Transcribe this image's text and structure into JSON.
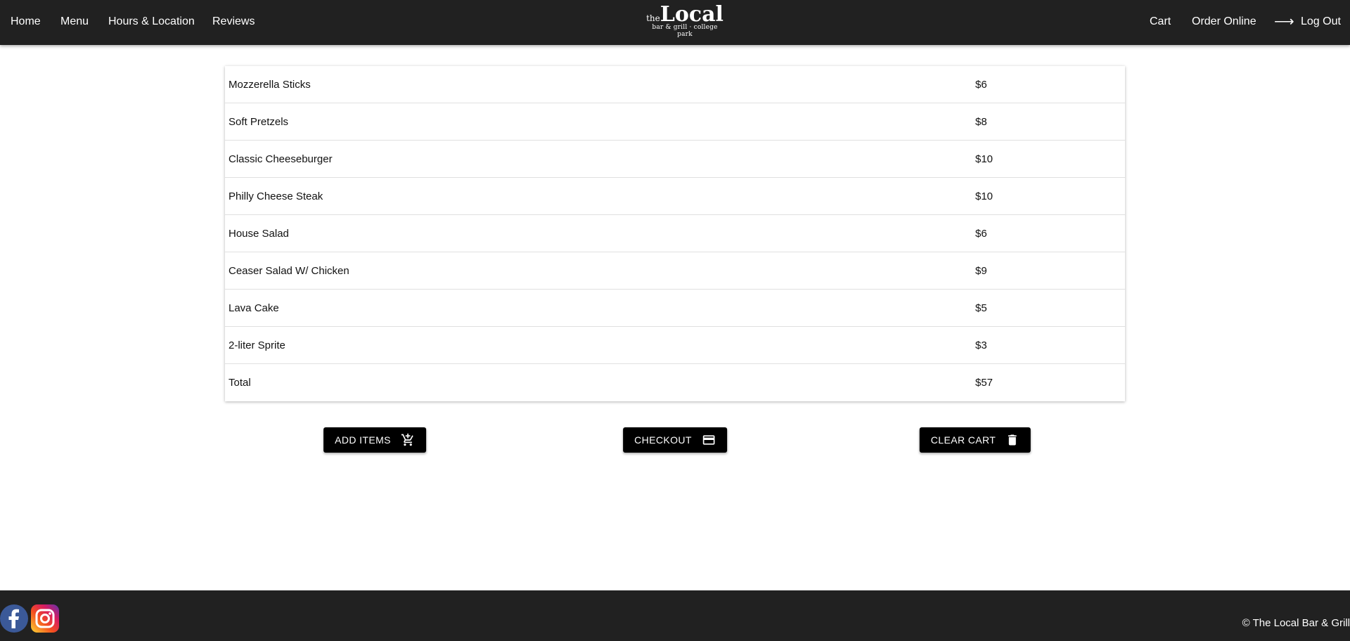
{
  "nav": {
    "left": [
      "Home",
      "Menu",
      "Hours & Location",
      "Reviews"
    ],
    "right": {
      "cart": "Cart",
      "order": "Order Online",
      "logout": "Log Out"
    },
    "logo": {
      "the": "the",
      "name": "Local",
      "tagline": "bar & grill · college park"
    }
  },
  "cart": {
    "items": [
      {
        "name": "Mozzerella Sticks",
        "price": "$6"
      },
      {
        "name": "Soft Pretzels",
        "price": "$8"
      },
      {
        "name": "Classic Cheeseburger",
        "price": "$10"
      },
      {
        "name": "Philly Cheese Steak",
        "price": "$10"
      },
      {
        "name": "House Salad",
        "price": "$6"
      },
      {
        "name": "Ceaser Salad W/ Chicken",
        "price": "$9"
      },
      {
        "name": "Lava Cake",
        "price": "$5"
      },
      {
        "name": "2-liter Sprite",
        "price": "$3"
      },
      {
        "name": "Total",
        "price": "$57"
      }
    ]
  },
  "buttons": {
    "add": "ADD ITEMS",
    "checkout": "CHECKOUT",
    "clear": "CLEAR CART"
  },
  "footer": {
    "copyright": "© The Local Bar & Grill"
  }
}
